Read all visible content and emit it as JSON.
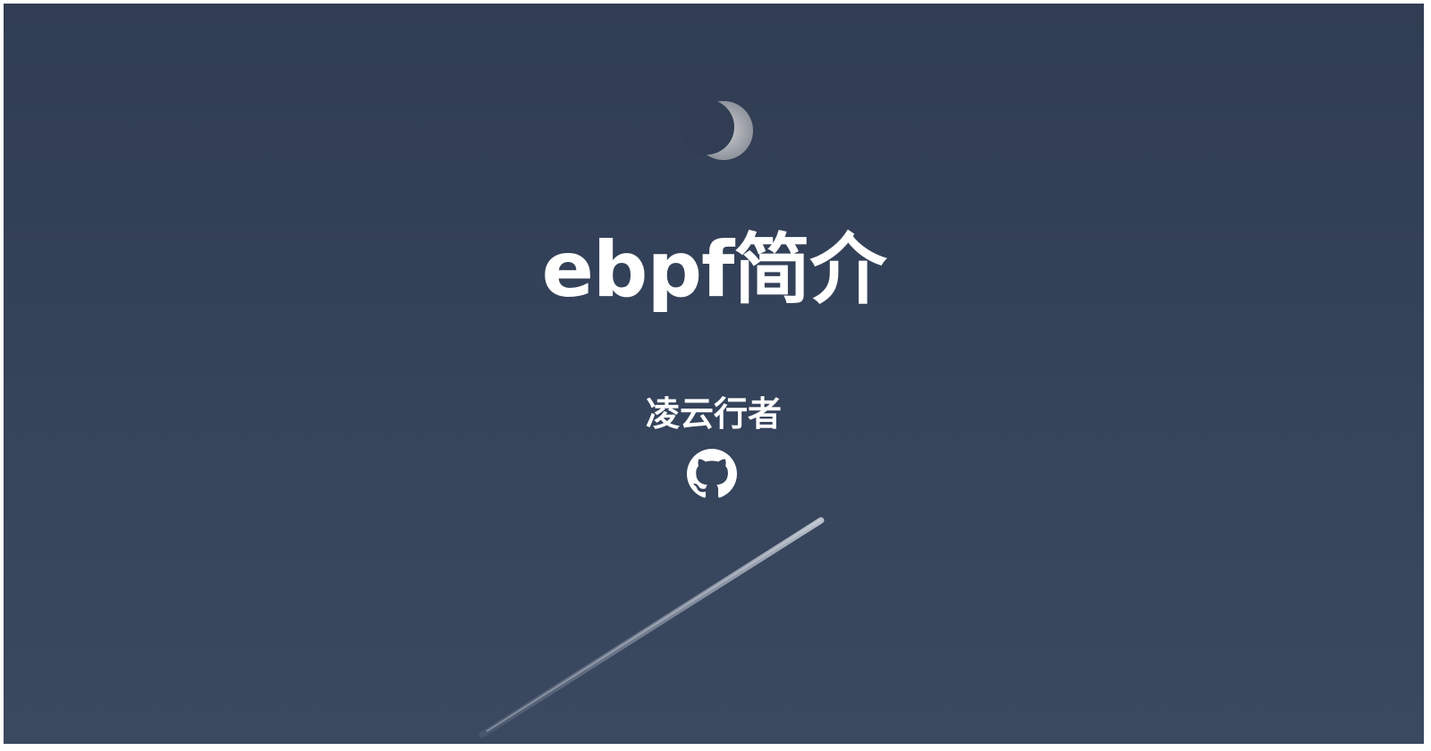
{
  "slide": {
    "title": "ebpf简介",
    "author": "凌云行者"
  },
  "icons": {
    "github": "github-icon",
    "moon": "moon",
    "contrail": "airplane-contrail"
  },
  "colors": {
    "background": "#34425a",
    "text": "#ffffff"
  }
}
